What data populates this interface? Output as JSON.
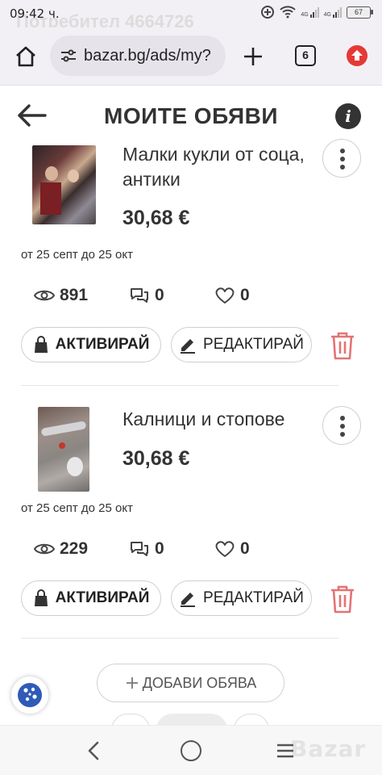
{
  "status_bar": {
    "time": "09:42 ч.",
    "user_watermark": "Потребител 4664726",
    "signal_label_1": "4G",
    "signal_label_2": "4G",
    "battery": "67"
  },
  "browser": {
    "url": "bazar.bg/ads/my?",
    "tab_count": "6"
  },
  "header": {
    "title": "МОИТЕ ОБЯВИ"
  },
  "listings": [
    {
      "title": "Малки кукли от соца, антики",
      "price": "30,68 €",
      "dates": "от 25 септ до 25 окт",
      "views": "891",
      "messages": "0",
      "favorites": "0",
      "activate_label": "АКТИВИРАЙ",
      "edit_label": "РЕДАКТИРАЙ"
    },
    {
      "title": "Калници и стопове",
      "price": "30,68 €",
      "dates": "от 25 септ до 25 окт",
      "views": "229",
      "messages": "0",
      "favorites": "0",
      "activate_label": "АКТИВИРАЙ",
      "edit_label": "РЕДАКТИРАЙ"
    }
  ],
  "footer": {
    "add_ad_label": "ДОБАВИ ОБЯВА",
    "brand_watermark": "Bazar"
  },
  "colors": {
    "accent_red": "#e53935",
    "delete_red": "#e57373",
    "text": "#333333",
    "browser_bg": "#f3f0f5"
  },
  "icons": [
    "home-icon",
    "tune-icon",
    "plus-icon",
    "tabs-icon",
    "update-icon",
    "back-arrow-icon",
    "info-icon",
    "more-vertical-icon",
    "eye-icon",
    "chat-icon",
    "heart-icon",
    "bag-icon",
    "pencil-icon",
    "trash-icon",
    "cookie-icon"
  ]
}
